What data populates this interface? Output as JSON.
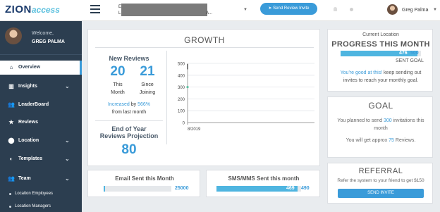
{
  "brand": {
    "name": "ZION",
    "suffix": "access"
  },
  "sidebar": {
    "welcome": "Welcome,",
    "user_name": "GREG PALMA",
    "items": [
      {
        "label": "Overview",
        "icon": "home-icon",
        "active": true,
        "expandable": false
      },
      {
        "label": "Insights",
        "icon": "bar-chart-icon",
        "active": false,
        "expandable": true
      },
      {
        "label": "LeaderBoard",
        "icon": "users-icon",
        "active": false,
        "expandable": false
      },
      {
        "label": "Reviews",
        "icon": "star-icon",
        "active": false,
        "expandable": false
      },
      {
        "label": "Location",
        "icon": "map-pin-icon",
        "active": false,
        "expandable": true
      },
      {
        "label": "Templates",
        "icon": "palette-icon",
        "active": false,
        "expandable": true
      },
      {
        "label": "Team",
        "icon": "team-icon",
        "active": false,
        "expandable": true
      }
    ],
    "sub_items": [
      "Location Employees",
      "Location Managers"
    ]
  },
  "topbar": {
    "location_line1": "E",
    "location_line2": "L",
    "location_suffix": "A...",
    "send_button": "Send Review Invite",
    "user_name": "Greg Palma"
  },
  "growth": {
    "title": "GROWTH",
    "new_reviews_label": "New Reviews",
    "this_month_value": "20",
    "this_month_label_1": "This",
    "this_month_label_2": "Month",
    "since_joining_value": "21",
    "since_joining_label_1": "Since",
    "since_joining_label_2": "Joining",
    "increase_prefix": "Increased",
    "increase_by": "by",
    "increase_value": "566%",
    "increase_suffix": "from last month",
    "projection_label_1": "End of Year",
    "projection_label_2": "Reviews Projection",
    "projection_value": "80"
  },
  "chart_data": {
    "type": "line",
    "x": [
      "8/2019"
    ],
    "series": [
      {
        "values": [
          300
        ]
      }
    ],
    "yticks": [
      0,
      100,
      200,
      300,
      400,
      500
    ],
    "ylim": [
      0,
      500
    ],
    "grid": true,
    "colors": {
      "line": "#2a2a2a",
      "point": "#5bc0a0"
    }
  },
  "email": {
    "title": "Email Sent this Month",
    "value": "25000",
    "fraction": 0.02
  },
  "sms": {
    "title": "SMS/MMS Sent this month",
    "value": "469",
    "max": "490",
    "fraction": 0.957
  },
  "progress": {
    "location_label": "Current Location",
    "title": "PROGRESS THIS MONTH",
    "bar_value": "476",
    "bar_max": "500",
    "fraction": 0.952,
    "sub_label": "SENT GOAL",
    "encourage_highlight": "You're good at this!",
    "encourage_rest_1": "keep sending out",
    "encourage_rest_2": "invites to reach your monthly goal."
  },
  "goal": {
    "title": "GOAL",
    "line1_prefix": "You planned to send",
    "line1_value": "300",
    "line1_suffix": "invitations this",
    "line2": "month",
    "line3_prefix": "You will get approx",
    "line3_value": "75",
    "line3_suffix": "Reviews."
  },
  "referral": {
    "title": "REFERRAL",
    "text": "Refer the system to your friend to get $150",
    "button": "SEND INVITE"
  },
  "colors": {
    "accent": "#3a9bd9",
    "sidebar": "#2c3e50",
    "bar": "#4fb5e0"
  }
}
